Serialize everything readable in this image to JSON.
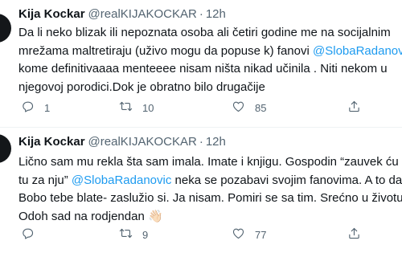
{
  "tweets": [
    {
      "display_name": "Kija Kockar",
      "handle": "@realKIJAKOCKAR",
      "separator": "·",
      "time": "12h",
      "lines": [
        [
          {
            "text": "Da li neko blizak ili nepoznata osoba ali četiri godine me na socijalnim",
            "mention": false
          }
        ],
        [
          {
            "text": "mrežama maltretiraju (uživo mogu da popuse k) fanovi ",
            "mention": false
          },
          {
            "text": "@SlobaRadanovic",
            "mention": true
          }
        ],
        [
          {
            "text": "kome definitivaaaa menteeee nisam ništa nikad učinila . Niti nekom u",
            "mention": false
          }
        ],
        [
          {
            "text": "njegovoj porodici.Dok  je obratno bilo drugačije",
            "mention": false
          }
        ]
      ],
      "actions": {
        "reply_icon": "reply-icon",
        "reply_count": "1",
        "retweet_icon": "retweet-icon",
        "retweet_count": "10",
        "like_icon": "heart-icon",
        "like_count": "85",
        "share_icon": "share-icon"
      }
    },
    {
      "display_name": "Kija Kockar",
      "handle": "@realKIJAKOCKAR",
      "separator": "·",
      "time": "12h",
      "lines": [
        [
          {
            "text": "Lično sam mu rekla šta sam imala. Imate i knjigu. Gospodin “zauvek ću biti",
            "mention": false
          }
        ],
        [
          {
            "text": "tu za nju” ",
            "mention": false
          },
          {
            "text": "@SlobaRadanovic",
            "mention": true
          },
          {
            "text": " neka se pozabavi svojim fanovima. A to da",
            "mention": false
          }
        ],
        [
          {
            "text": "Bobo tebe blate- zaslužio si. Ja nisam. Pomiri se sa tim. Srećno u životu.",
            "mention": false
          }
        ],
        [
          {
            "text": "Odoh sad na rodjendan 👋🏻",
            "mention": false
          }
        ]
      ],
      "actions": {
        "reply_icon": "reply-icon",
        "reply_count": "",
        "retweet_icon": "retweet-icon",
        "retweet_count": "9",
        "like_icon": "heart-icon",
        "like_count": "77",
        "share_icon": "share-icon"
      }
    }
  ]
}
